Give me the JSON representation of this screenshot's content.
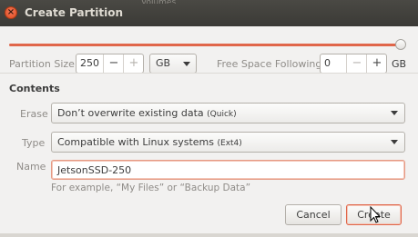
{
  "window": {
    "title": "Create Partition",
    "background_text": "Volumes"
  },
  "size_row": {
    "partition_size_label": "Partition Size",
    "partition_size_value": "250",
    "unit": "GB",
    "free_space_label": "Free Space Following",
    "free_space_value": "0",
    "free_space_unit": "GB",
    "slider_fraction": 1.0
  },
  "contents": {
    "heading": "Contents",
    "erase_label": "Erase",
    "erase_value": "Don’t overwrite existing data",
    "erase_hint": "(Quick)",
    "type_label": "Type",
    "type_value": "Compatible with Linux systems",
    "type_hint": "(Ext4)",
    "name_label": "Name",
    "name_value": "JetsonSSD-250",
    "name_example": "For example, “My Files” or “Backup Data”"
  },
  "buttons": {
    "cancel": "Cancel",
    "create": "Create"
  },
  "colors": {
    "accent": "#e0664a",
    "titlebar": "#3c3b37",
    "dialog_bg": "#f2f1f0"
  }
}
